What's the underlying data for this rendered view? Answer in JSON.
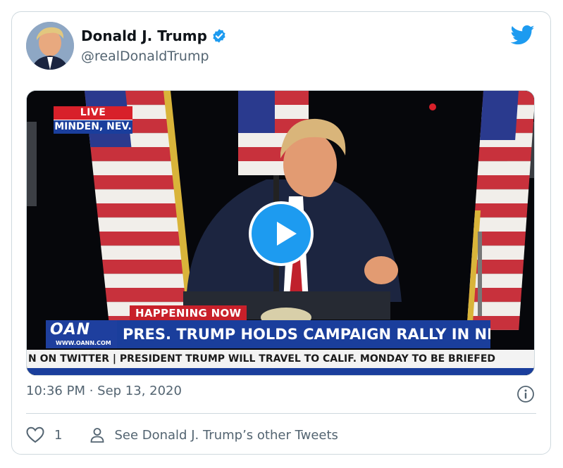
{
  "tweet": {
    "author_name": "Donald J. Trump",
    "author_handle": "@realDonaldTrump",
    "timestamp": "10:36 PM · Sep 13, 2020",
    "like_count": "1",
    "other_tweets_label": "See Donald J. Trump’s other Tweets",
    "verified": true,
    "icons": [
      "twitter-bird-icon",
      "verified-badge-icon",
      "play-icon",
      "info-icon",
      "heart-icon",
      "person-icon"
    ]
  },
  "video": {
    "live_label": "LIVE",
    "location_label": "MINDEN, NEV.",
    "happening_label": "HAPPENING NOW",
    "network_logo": "OAN",
    "network_site": "WWW.OANN.COM",
    "headline": "PRES. TRUMP HOLDS CAMPAIGN RALLY IN NEVADA",
    "ticker": "N ON TWITTER  |  PRESIDENT TRUMP WILL TRAVEL TO CALIF. MONDAY TO BE BRIEFED"
  },
  "colors": {
    "twitter_blue": "#1d9bf0",
    "text_primary": "#0f1419",
    "text_secondary": "#536471",
    "border": "#cfd9de",
    "oan_blue": "#1a3e9c",
    "live_red": "#d8202a"
  }
}
